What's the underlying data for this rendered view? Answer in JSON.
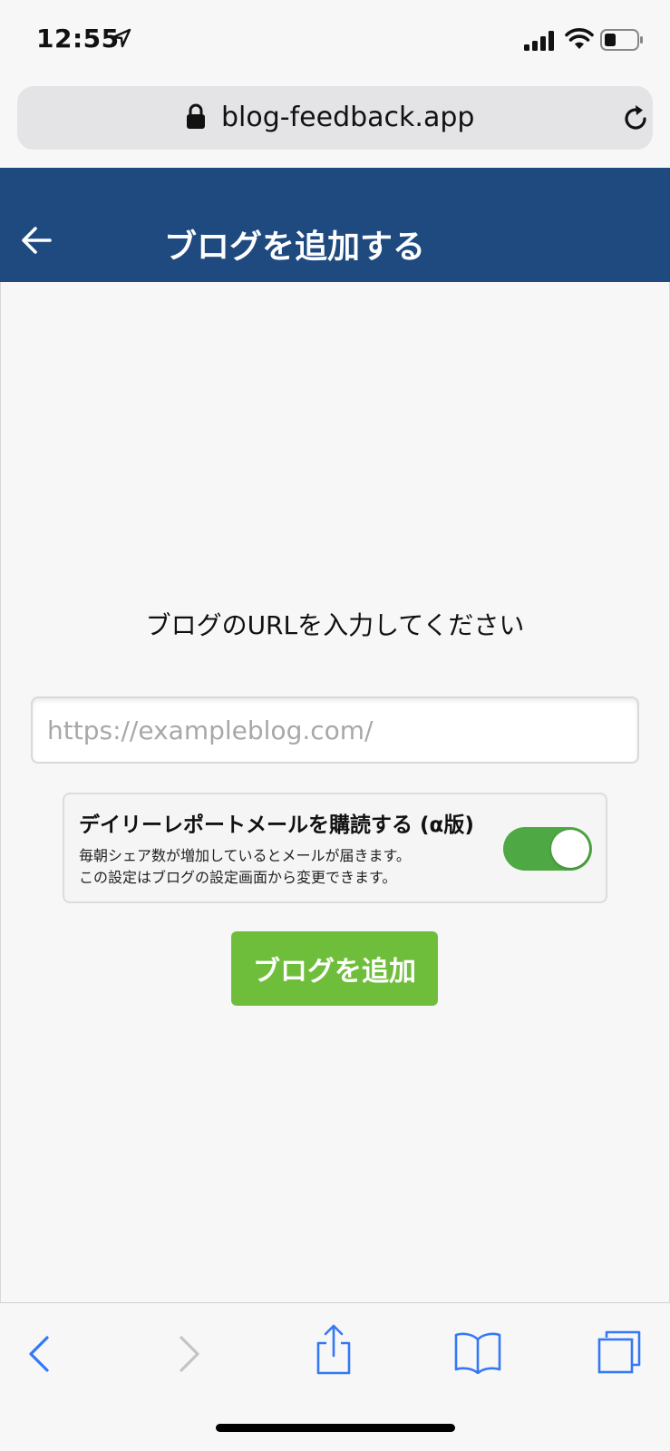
{
  "status_bar": {
    "time": "12:55",
    "icons": [
      "location-arrow-icon",
      "signal-icon",
      "wifi-icon",
      "battery-icon"
    ]
  },
  "browser": {
    "url": "blog-feedback.app",
    "icons": [
      "lock-icon",
      "reload-icon"
    ]
  },
  "header": {
    "title": "ブログを追加する",
    "background": "#1e4a80"
  },
  "form": {
    "prompt": "ブログのURLを入力してください",
    "url_input": {
      "value": "",
      "placeholder": "https://exampleblog.com/"
    },
    "subscribe": {
      "title": "デイリーレポートメールを購読する (α版)",
      "description_line1": "毎朝シェア数が増加しているとメールが届きます。",
      "description_line2": "この設定はブログの設定画面から変更できます。",
      "toggle_on": true,
      "toggle_color": "#4ea843"
    },
    "submit_label": "ブログを追加",
    "submit_color": "#6fbe3b"
  },
  "toolbar": {
    "icons": [
      "back-icon",
      "forward-icon",
      "share-icon",
      "bookmarks-icon",
      "tabs-icon"
    ],
    "accent": "#3478f6"
  }
}
